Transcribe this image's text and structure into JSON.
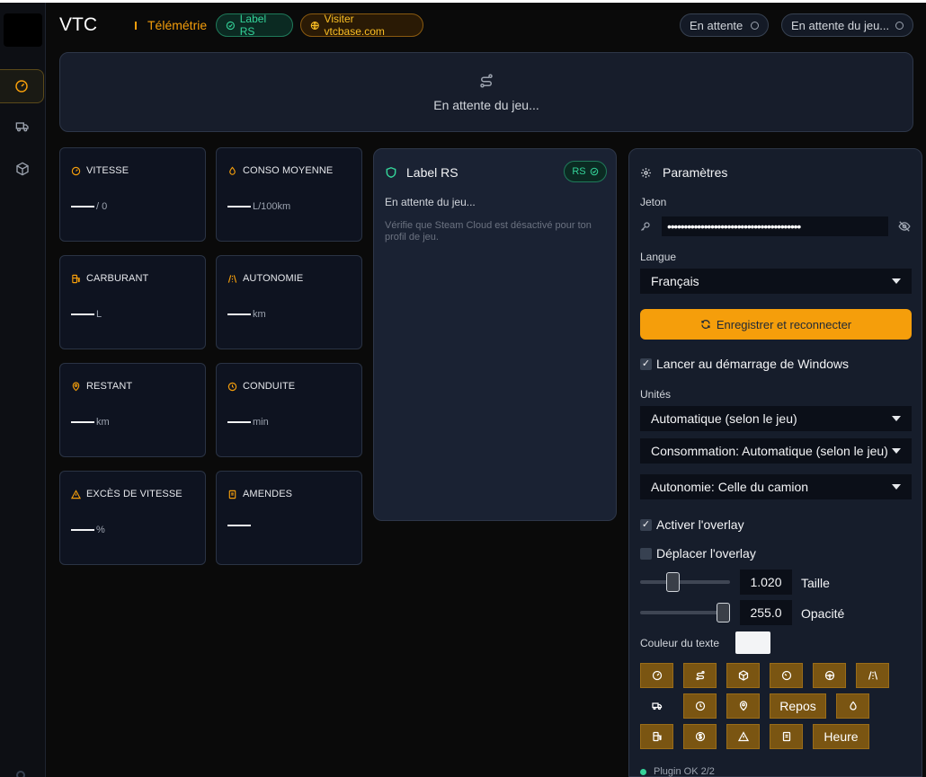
{
  "app": {
    "title": "VTC",
    "section": "Télémétrie",
    "label_pill": "Label RS",
    "visit_pill": "Visiter vtcbase.com",
    "status1": "En attente",
    "status2": "En attente du jeu..."
  },
  "sidebar": {
    "items": [
      {
        "icon": "gauge-icon",
        "active": true
      },
      {
        "icon": "truck-icon",
        "active": false
      },
      {
        "icon": "package-icon",
        "active": false
      }
    ]
  },
  "banner": {
    "text": "En attente du jeu..."
  },
  "stats": [
    {
      "label": "VITESSE",
      "value": "/ 0",
      "icon": "speedometer-icon"
    },
    {
      "label": "CONSO MOYENNE",
      "value": "L/100km",
      "icon": "droplet-icon"
    },
    {
      "label": "CARBURANT",
      "value": "L",
      "icon": "fuel-icon"
    },
    {
      "label": "AUTONOMIE",
      "value": "km",
      "icon": "road-icon"
    },
    {
      "label": "RESTANT",
      "value": "km",
      "icon": "map-pin-icon"
    },
    {
      "label": "CONDUITE",
      "value": "min",
      "icon": "clock-icon"
    },
    {
      "label": "EXCÈS DE VITESSE",
      "value": "%",
      "icon": "warning-icon"
    },
    {
      "label": "AMENDES",
      "value": "",
      "icon": "receipt-icon"
    }
  ],
  "label_rs": {
    "title": "Label RS",
    "badge": "RS",
    "status": "En attente du jeu...",
    "hint": "Vérifie que Steam Cloud est désactivé pour ton profil de jeu."
  },
  "settings": {
    "title": "Paramètres",
    "token_label": "Jeton",
    "token_value": "••••••••••••••••••••••••••••••••••••••••",
    "language_label": "Langue",
    "language": "Français",
    "save_button": "Enregistrer et reconnecter",
    "autostart": "Lancer au démarrage de Windows",
    "autostart_checked": true,
    "units_label": "Unités",
    "units": "Automatique (selon le jeu)",
    "consumption": "Consommation: Automatique (selon le jeu)",
    "autonomy": "Autonomie: Celle du camion",
    "overlay_enable": "Activer l'overlay",
    "overlay_enable_checked": true,
    "overlay_move": "Déplacer l'overlay",
    "overlay_move_checked": false,
    "size_value": "1.020",
    "size_label": "Taille",
    "size_level": 0.34,
    "opacity_value": "255.0",
    "opacity_label": "Opacité",
    "opacity_level": 1.0,
    "text_color_label": "Couleur du texte",
    "text_color": "#f3f4f6",
    "toggles_row1": [
      "speedometer-icon",
      "route-icon",
      "package-icon",
      "gauge-icon",
      "steering-icon",
      "road-icon"
    ],
    "toggles_row2_rest_label": "Repos",
    "toggles_row3_time_label": "Heure",
    "plugin_status": "Plugin OK 2/2"
  },
  "colors": {
    "accent": "#f59e0b",
    "success": "#34d399",
    "panel": "#161d2b"
  }
}
